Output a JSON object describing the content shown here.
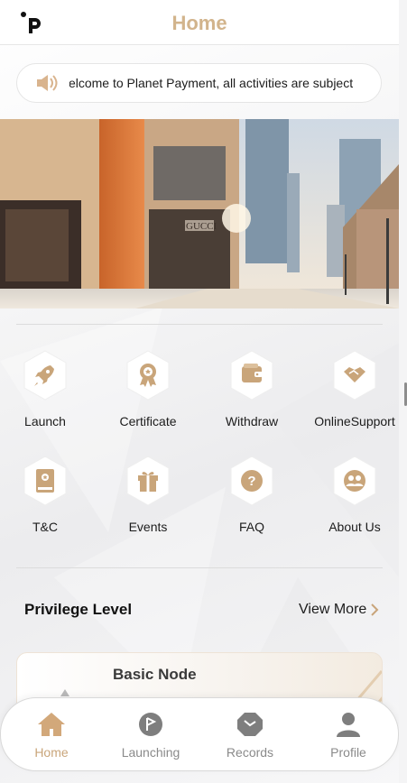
{
  "header": {
    "title": "Home",
    "logo_text": "p"
  },
  "notice": {
    "text": "Welcome to Planet Payment, all activities are subject to"
  },
  "banner": {
    "storefront_text": "GUCCI"
  },
  "grid": [
    {
      "label": "Launch",
      "icon": "rocket-icon"
    },
    {
      "label": "Certificate",
      "icon": "award-icon"
    },
    {
      "label": "Withdraw",
      "icon": "wallet-icon"
    },
    {
      "label": "OnlineSupport",
      "icon": "handshake-icon"
    },
    {
      "label": "T&C",
      "icon": "book-icon"
    },
    {
      "label": "Events",
      "icon": "gift-icon"
    },
    {
      "label": "FAQ",
      "icon": "question-icon"
    },
    {
      "label": "About Us",
      "icon": "users-icon"
    }
  ],
  "privilege": {
    "title": "Privilege Level",
    "view_more": "View More"
  },
  "node_card": {
    "title": "Basic Node"
  },
  "tabbar": [
    {
      "label": "Home",
      "icon": "home-icon",
      "active": true
    },
    {
      "label": "Launching",
      "icon": "launching-icon",
      "active": false
    },
    {
      "label": "Records",
      "icon": "records-icon",
      "active": false
    },
    {
      "label": "Profile",
      "icon": "profile-icon",
      "active": false
    }
  ],
  "colors": {
    "accent": "#d2b48c",
    "icon_gold": "#c9a57a",
    "tab_inactive": "#8a8a8a"
  }
}
